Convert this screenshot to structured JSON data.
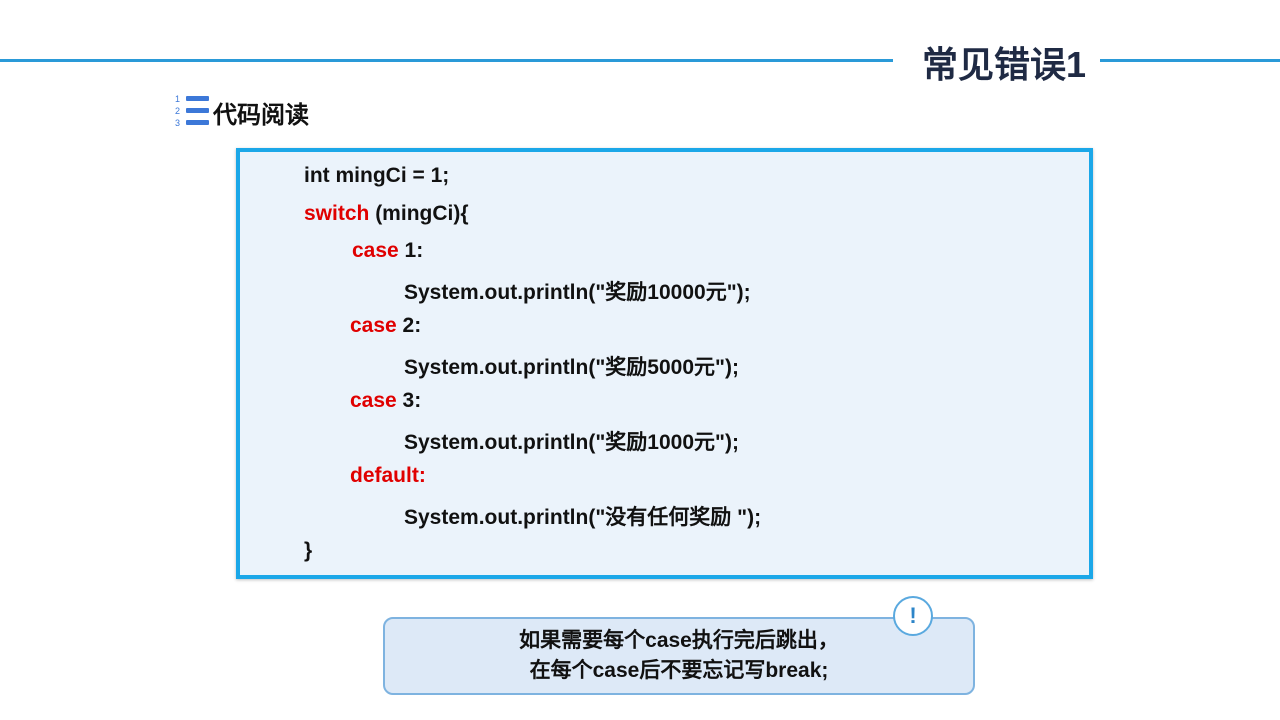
{
  "slide": {
    "title": "常见错误1"
  },
  "section": {
    "numbers": [
      "1",
      "2",
      "3"
    ],
    "label": "代码阅读"
  },
  "code": {
    "line1": "int mingCi = 1;",
    "line2_kw": "switch",
    "line2_rest": " (mingCi){",
    "line3_kw": "case",
    "line3_rest": " 1:",
    "line4": "System.out.println(\"奖励10000元\");",
    "line5_kw": "case",
    "line5_rest": " 2:",
    "line6": "System.out.println(\"奖励5000元\");",
    "line7_kw": "case",
    "line7_rest": " 3:",
    "line8": "System.out.println(\"奖励1000元\");",
    "line9_kw": "default:",
    "line10": "System.out.println(\"没有任何奖励 \");",
    "line11": "}"
  },
  "note": {
    "line1": "如果需要每个case执行完后跳出，",
    "line2": "在每个case后不要忘记写break;",
    "icon_symbol": "!"
  },
  "colors": {
    "accent_line": "#2a9ad8",
    "code_border": "#1ba7e8",
    "keyword": "#e00000",
    "title": "#1f2a44"
  }
}
